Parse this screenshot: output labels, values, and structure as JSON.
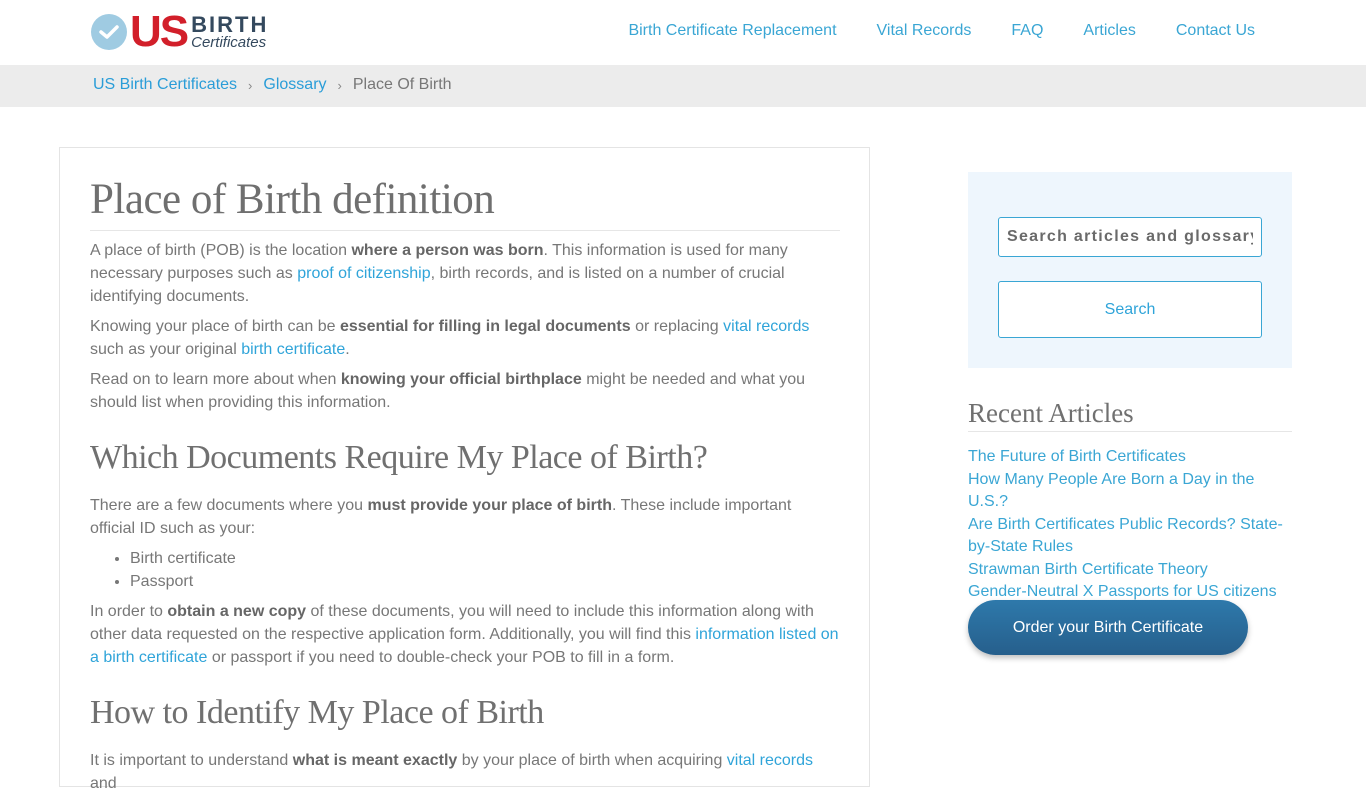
{
  "header": {
    "logo": {
      "us": "US",
      "birth": "BIRTH",
      "certificates": "Certificates"
    },
    "nav": [
      {
        "label": "Birth Certificate Replacement"
      },
      {
        "label": "Vital Records"
      },
      {
        "label": "FAQ"
      },
      {
        "label": "Articles"
      },
      {
        "label": "Contact Us"
      }
    ]
  },
  "breadcrumb": {
    "items": [
      {
        "label": "US Birth Certificates"
      },
      {
        "label": "Glossary"
      }
    ],
    "separator": "›",
    "current": "Place Of Birth"
  },
  "article": {
    "title": "Place of Birth definition",
    "intro": {
      "t1": "A place of birth (POB) is the location ",
      "b1": "where a person was born",
      "t2": ". This information is used for many necessary purposes such as ",
      "l1": "proof of citizenship",
      "t3": ", birth records, and is listed on a number of crucial identifying documents."
    },
    "p2": {
      "t1": "Knowing your place of birth can be ",
      "b1": "essential for filling in legal documents",
      "t2": " or replacing ",
      "l1": "vital records",
      "t3": " such as your original ",
      "l2": "birth certificate",
      "t4": "."
    },
    "p3": {
      "t1": "Read on to learn more about when ",
      "b1": "knowing your official birthplace",
      "t2": " might be needed and what you should list when providing this information."
    },
    "section1": {
      "heading": "Which Documents Require My Place of Birth?",
      "p1": {
        "t1": "There are a few documents where you ",
        "b1": "must provide your place of birth",
        "t2": ". These include important official ID such as your:"
      },
      "list": [
        "Birth certificate",
        "Passport"
      ],
      "p2": {
        "t1": "In order to ",
        "b1": "obtain a new copy",
        "t2": " of these documents, you will need to include this information along with other data requested on the respective application form. Additionally, you will find this ",
        "l1": "information listed on a birth certificate",
        "t3": " or passport if you need to double-check your POB to fill in a form."
      }
    },
    "section2": {
      "heading": "How to Identify My Place of Birth",
      "p1": {
        "t1": "It is important to understand ",
        "b1": "what is meant exactly",
        "t2": " by your place of birth when acquiring ",
        "l1": "vital records",
        "t3": " and"
      }
    }
  },
  "sidebar": {
    "search": {
      "placeholder": "Search articles and glossary",
      "button_label": "Search"
    },
    "recent": {
      "heading": "Recent Articles",
      "items": [
        {
          "label": "The Future of Birth Certificates"
        },
        {
          "label": "How Many People Are Born a Day in the U.S.?"
        },
        {
          "label": "Are Birth Certificates Public Records? State-by-State Rules"
        },
        {
          "label": "Strawman Birth Certificate Theory"
        },
        {
          "label": "Gender-Neutral X Passports for US citizens"
        }
      ]
    },
    "order_button": "Order your Birth Certificate"
  },
  "colors": {
    "link": "#2fa4d9",
    "brand_red": "#d21f2a",
    "brand_navy": "#34495e",
    "order_button": "#2a6d9c",
    "search_panel_bg": "#eef6fd"
  }
}
